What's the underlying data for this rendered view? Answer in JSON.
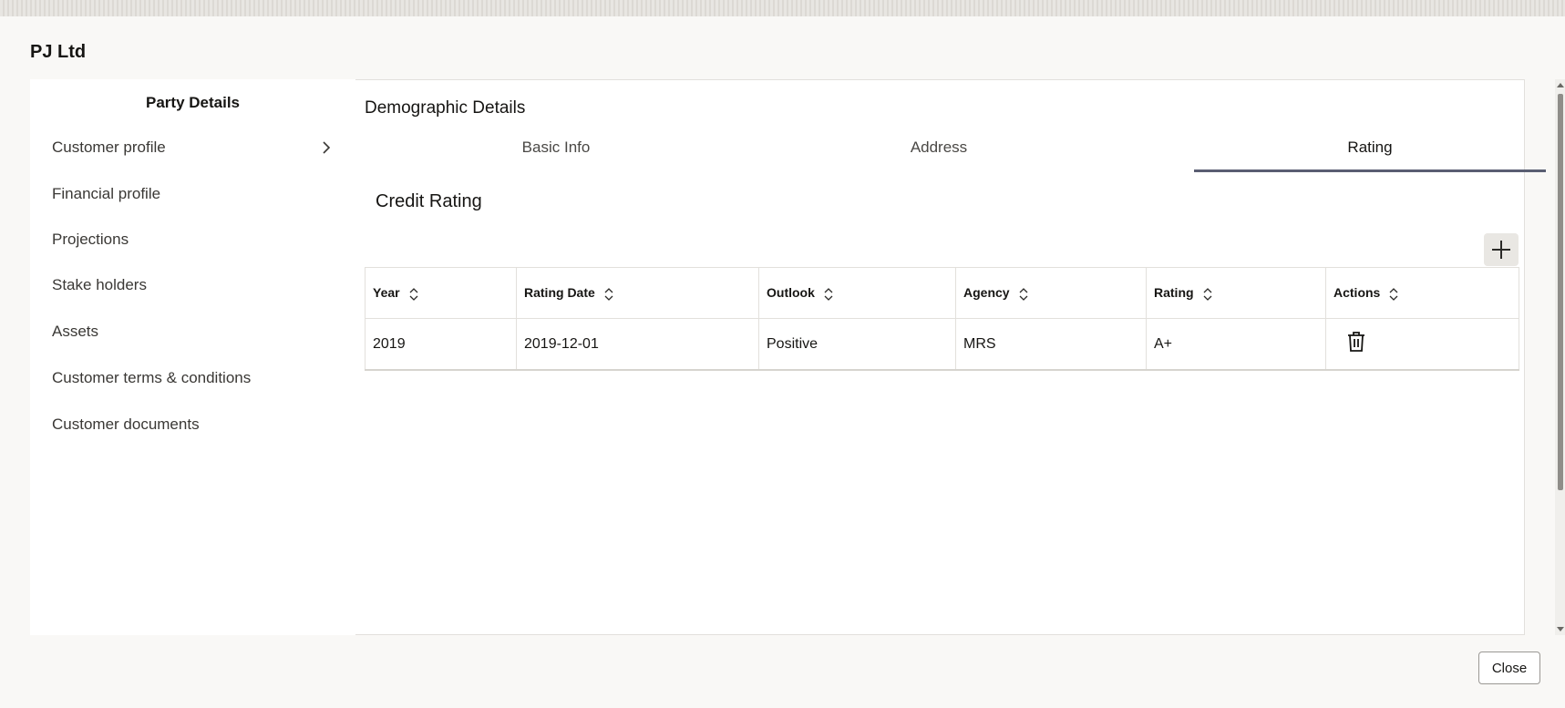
{
  "dialog": {
    "title": "PJ Ltd",
    "close_label": "Close"
  },
  "sidebar": {
    "title": "Party Details",
    "items": [
      {
        "label": "Customer profile"
      },
      {
        "label": "Financial profile"
      },
      {
        "label": "Projections"
      },
      {
        "label": "Stake holders"
      },
      {
        "label": "Assets"
      },
      {
        "label": "Customer terms & conditions"
      },
      {
        "label": "Customer documents"
      }
    ]
  },
  "main": {
    "title": "Demographic Details",
    "tabs": [
      {
        "label": "Basic Info"
      },
      {
        "label": "Address"
      },
      {
        "label": "Rating",
        "active": true
      }
    ],
    "section_title": "Credit Rating",
    "table": {
      "headers": [
        "Year",
        "Rating Date",
        "Outlook",
        "Agency",
        "Rating",
        "Actions"
      ],
      "rows": [
        {
          "year": "2019",
          "rating_date": "2019-12-01",
          "outlook": "Positive",
          "agency": "MRS",
          "rating": "A+"
        }
      ]
    }
  },
  "icons": {
    "add": "plus-icon",
    "delete": "trash-icon",
    "sort": "sort-updown-icon",
    "chevron": "chevron-right-icon"
  },
  "colors": {
    "active_tab_underline": "#5a5e72",
    "background": "#f9f8f6",
    "panel": "#ffffff"
  }
}
